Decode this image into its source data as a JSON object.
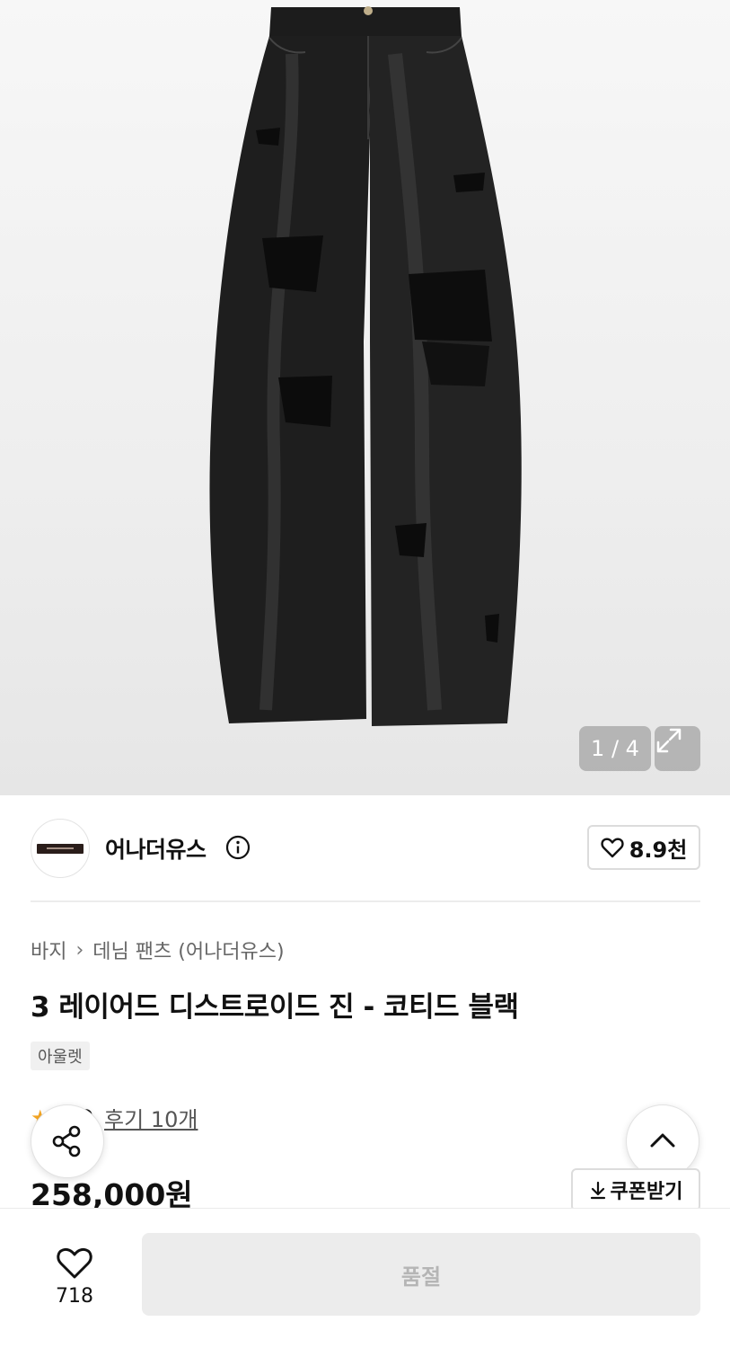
{
  "gallery": {
    "counter": "1 / 4",
    "product_image_alt": "black distressed coated barrel jeans"
  },
  "brand": {
    "name": "어나더유스",
    "likes": "8.9천"
  },
  "product": {
    "breadcrumb": [
      "바지",
      "데님 팬츠 (어나더유스)"
    ],
    "title": "3 레이어드 디스트로이드 진 - 코티드 블랙",
    "tag": "아울렛",
    "rating": "5.0",
    "reviews": "후기 10개",
    "price": "258,000원",
    "coupon_label": "쿠폰받기"
  },
  "bottom_bar": {
    "wish_count": "718",
    "buy_label": "품절"
  },
  "colors": {
    "star": "#f5a623",
    "soldout_bg": "#ececec",
    "soldout_text": "#b5b5b5"
  }
}
